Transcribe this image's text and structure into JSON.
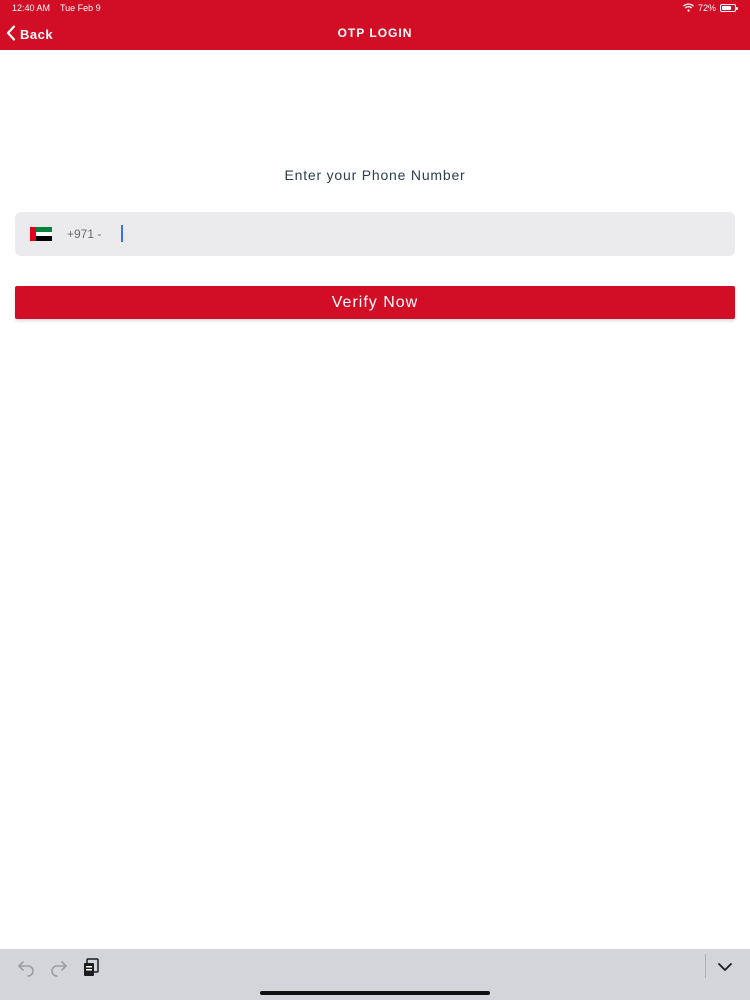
{
  "status_bar": {
    "time": "12:40 AM",
    "date": "Tue Feb 9",
    "battery": "72%",
    "battery_level": 0.72,
    "wifi_icon": "wifi-icon"
  },
  "nav": {
    "back_label": "Back",
    "title": "OTP LOGIN"
  },
  "main": {
    "prompt": "Enter your Phone Number",
    "country_flag": "uae-flag-icon",
    "dial_code": "+971 -",
    "phone_value": "",
    "verify_label": "Verify Now"
  },
  "keyboard_toolbar": {
    "icons": [
      "undo-icon",
      "redo-icon",
      "paste-icon",
      "dismiss-keyboard-icon"
    ]
  },
  "colors": {
    "brand_red": "#d10e25",
    "input_bg": "#ebebed",
    "prompt_text": "#2c3e50",
    "caret": "#3b6df0"
  }
}
